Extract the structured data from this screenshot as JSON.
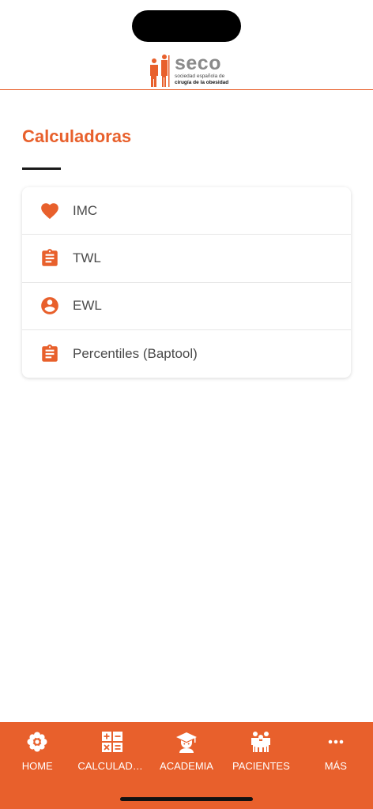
{
  "header": {
    "logo_word": "seco",
    "logo_line1": "sociedad española de",
    "logo_line2": "cirugía de la obesidad"
  },
  "page": {
    "title": "Calculadoras"
  },
  "calculators": [
    {
      "label": "IMC",
      "icon": "heart-icon"
    },
    {
      "label": "TWL",
      "icon": "clipboard-icon"
    },
    {
      "label": "EWL",
      "icon": "user-circle-icon"
    },
    {
      "label": "Percentiles (Baptool)",
      "icon": "clipboard-icon"
    }
  ],
  "tabs": [
    {
      "label": "HOME",
      "icon": "flower-icon"
    },
    {
      "label": "CALCULADORAS",
      "icon": "calculator-icon"
    },
    {
      "label": "ACADEMIA",
      "icon": "graduate-icon"
    },
    {
      "label": "PACIENTES",
      "icon": "people-icon"
    },
    {
      "label": "MÁS",
      "icon": "more-icon"
    }
  ],
  "colors": {
    "accent": "#e8602c",
    "text": "#4a4a4a"
  }
}
